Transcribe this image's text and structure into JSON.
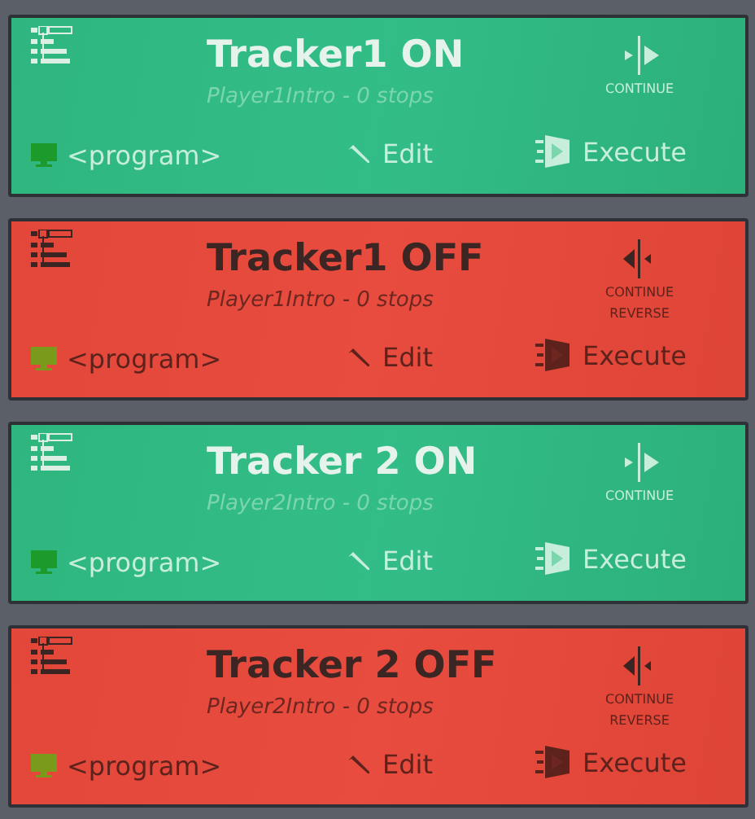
{
  "trackers": [
    {
      "title": "Tracker1 ON",
      "on": true,
      "subtitle": "Player1Intro - 0 stops",
      "continue_label": "CONTINUE",
      "program": "<program>",
      "edit": "Edit",
      "execute": "Execute"
    },
    {
      "title": "Tracker1 OFF",
      "on": false,
      "subtitle": "Player1Intro - 0 stops",
      "continue_label": "CONTINUE REVERSE",
      "program": "<program>",
      "edit": "Edit",
      "execute": "Execute"
    },
    {
      "title": "Tracker 2 ON",
      "on": true,
      "subtitle": "Player2Intro - 0 stops",
      "continue_label": "CONTINUE",
      "program": "<program>",
      "edit": "Edit",
      "execute": "Execute"
    },
    {
      "title": "Tracker 2 OFF",
      "on": false,
      "subtitle": "Player2Intro - 0 stops",
      "continue_label": "CONTINUE REVERSE",
      "program": "<program>",
      "edit": "Edit",
      "execute": "Execute"
    }
  ]
}
